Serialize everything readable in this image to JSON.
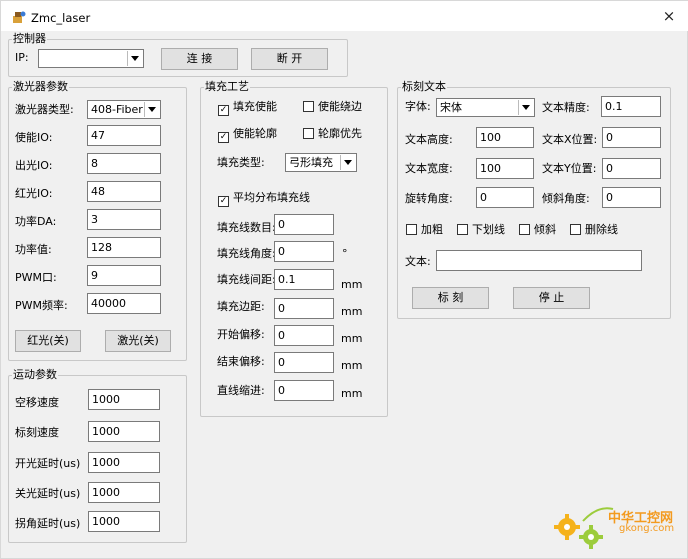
{
  "window": {
    "title": "Zmc_laser",
    "close_glyph": "×"
  },
  "controller": {
    "legend": "控制器",
    "ip_label": "IP:",
    "ip_value": "",
    "connect_label": "连 接",
    "disconnect_label": "断 开"
  },
  "laser": {
    "legend": "激光器参数",
    "type_label": "激光器类型:",
    "type_value": "408-Fiber",
    "rows": [
      {
        "label": "使能IO:",
        "value": "47"
      },
      {
        "label": "出光IO:",
        "value": "8"
      },
      {
        "label": "红光IO:",
        "value": "48"
      },
      {
        "label": "功率DA:",
        "value": "3"
      },
      {
        "label": "功率值:",
        "value": "128"
      },
      {
        "label": "PWM口:",
        "value": "9"
      },
      {
        "label": "PWM频率:",
        "value": "40000"
      }
    ],
    "red_btn": "红光(关)",
    "laser_btn": "激光(关)"
  },
  "motion": {
    "legend": "运动参数",
    "rows": [
      {
        "label": "空移速度",
        "value": "1000"
      },
      {
        "label": "标刻速度",
        "value": "1000"
      },
      {
        "label": "开光延时(us)",
        "value": "1000"
      },
      {
        "label": "关光延时(us)",
        "value": "1000"
      },
      {
        "label": "拐角延时(us)",
        "value": "1000"
      }
    ]
  },
  "fill": {
    "legend": "填充工艺",
    "enable": "填充使能",
    "around": "使能绕边",
    "outline": "使能轮廓",
    "outline_first": "轮廓优先",
    "type_label": "填充类型:",
    "type_value": "弓形填充",
    "even": "平均分布填充线",
    "rows": [
      {
        "label": "填充线数目:",
        "value": "0",
        "unit": ""
      },
      {
        "label": "填充线角度:",
        "value": "0",
        "unit": "°"
      },
      {
        "label": "填充线间距:",
        "value": "0.1",
        "unit": "mm"
      },
      {
        "label": "填充边距:",
        "value": "0",
        "unit": "mm"
      },
      {
        "label": "开始偏移:",
        "value": "0",
        "unit": "mm"
      },
      {
        "label": "结束偏移:",
        "value": "0",
        "unit": "mm"
      },
      {
        "label": "直线缩进:",
        "value": "0",
        "unit": "mm"
      }
    ]
  },
  "text": {
    "legend": "标刻文本",
    "font_label": "字体:",
    "font_value": "宋体",
    "precision_label": "文本精度:",
    "precision_value": "0.1",
    "height_label": "文本高度:",
    "height_value": "100",
    "xpos_label": "文本X位置:",
    "xpos_value": "0",
    "width_label": "文本宽度:",
    "width_value": "100",
    "ypos_label": "文本Y位置:",
    "ypos_value": "0",
    "rotate_label": "旋转角度:",
    "rotate_value": "0",
    "tilt_label": "倾斜角度:",
    "tilt_value": "0",
    "bold": "加粗",
    "underline": "下划线",
    "italic": "倾斜",
    "strike": "删除线",
    "text_label": "文本:",
    "text_value": "",
    "mark_btn": "标 刻",
    "stop_btn": "停 止"
  },
  "watermark": {
    "cn": "中华工控网",
    "url": "gkong.com"
  }
}
